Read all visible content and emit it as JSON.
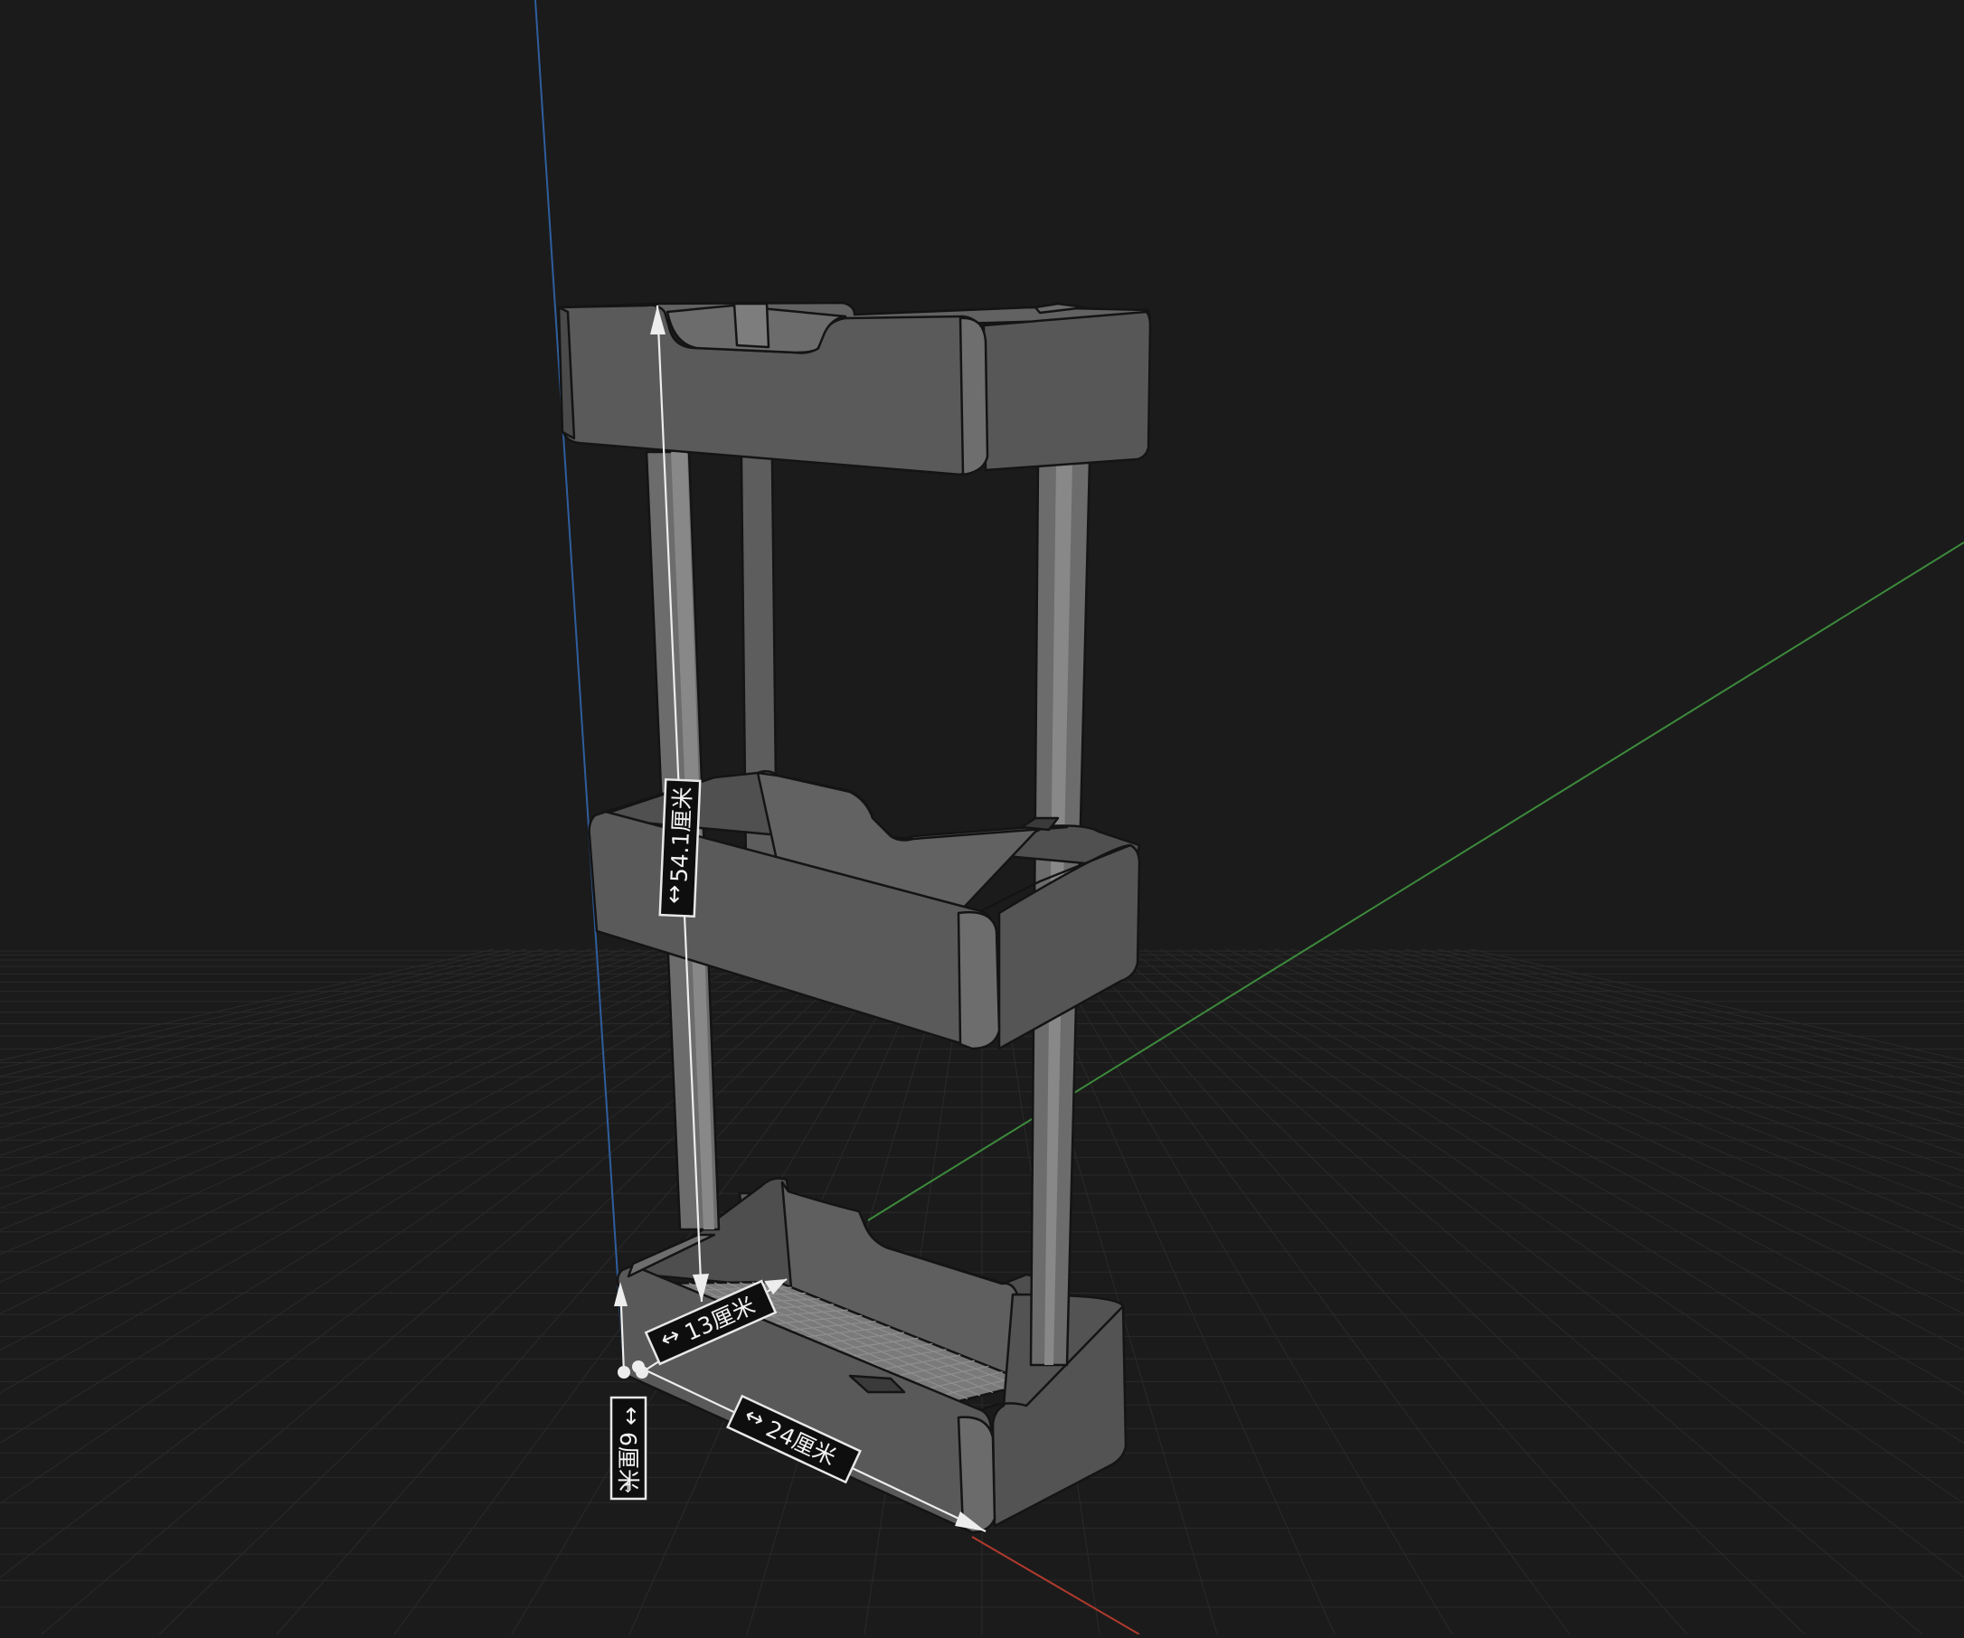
{
  "viewport": {
    "background": "#1b1b1b",
    "grid_color": "#2a2a2a",
    "axis_colors": {
      "vertical_blue": "#2f5e9e",
      "green": "#3c8a3c",
      "red": "#b03a2e"
    }
  },
  "model": {
    "body_fill": "#5a5a5a",
    "body_dark": "#4a4a4a",
    "inner_fill": "#6a6a6a",
    "edge_color": "#141414",
    "pole_fill": "#6c6c6c"
  },
  "dimensions": {
    "height": "54.1厘米",
    "depth": "13厘米",
    "width": "24厘米",
    "tray_height": "6厘米"
  }
}
